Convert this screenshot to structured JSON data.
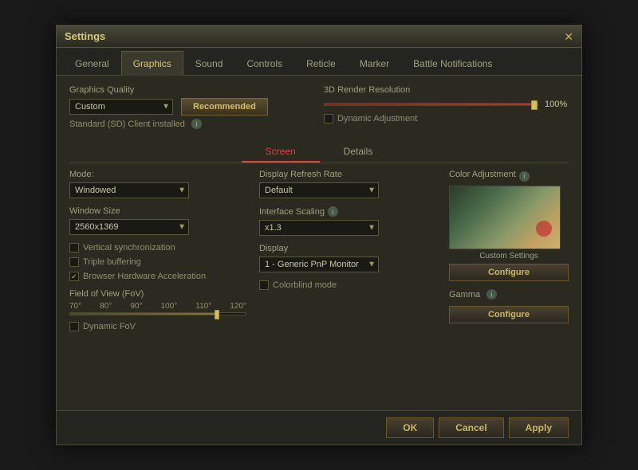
{
  "dialog": {
    "title": "Settings",
    "close_label": "✕"
  },
  "tabs": [
    {
      "id": "general",
      "label": "General",
      "active": false
    },
    {
      "id": "graphics",
      "label": "Graphics",
      "active": true
    },
    {
      "id": "sound",
      "label": "Sound",
      "active": false
    },
    {
      "id": "controls",
      "label": "Controls",
      "active": false
    },
    {
      "id": "reticle",
      "label": "Reticle",
      "active": false
    },
    {
      "id": "marker",
      "label": "Marker",
      "active": false
    },
    {
      "id": "battle_notifications",
      "label": "Battle Notifications",
      "active": false
    }
  ],
  "graphics": {
    "quality_label": "Graphics Quality",
    "quality_value": "Custom",
    "recommended_btn": "Recommended",
    "sd_label": "Standard (SD) Client installed",
    "render_label": "3D Render Resolution",
    "render_pct": "100%",
    "dynamic_adj_label": "Dynamic Adjustment",
    "sub_tabs": [
      {
        "id": "screen",
        "label": "Screen",
        "active": true
      },
      {
        "id": "details",
        "label": "Details",
        "active": false
      }
    ],
    "screen": {
      "mode_label": "Mode:",
      "mode_value": "Windowed",
      "window_size_label": "Window Size",
      "window_size_value": "2560x1369",
      "vertical_sync_label": "Vertical synchronization",
      "triple_buffer_label": "Triple buffering",
      "browser_hw_label": "Browser Hardware Acceleration",
      "browser_hw_checked": true,
      "fov_label": "Field of View (FoV)",
      "fov_markers": [
        "70°",
        "80°",
        "90°",
        "100°",
        "110°",
        "120°"
      ],
      "dynamic_fov_label": "Dynamic FoV",
      "display_refresh_label": "Display Refresh Rate",
      "display_refresh_value": "Default",
      "interface_scaling_label": "Interface Scaling",
      "interface_scaling_value": "x1.3",
      "display_label": "Display",
      "display_value": "1 - Generic PnP Monitor",
      "colorblind_label": "Colorblind mode",
      "color_adj_label": "Color Adjustment",
      "custom_settings_label": "Custom Settings",
      "configure_btn": "Configure",
      "gamma_label": "Gamma",
      "gamma_configure_btn": "Configure"
    }
  },
  "footer": {
    "ok_btn": "OK",
    "cancel_btn": "Cancel",
    "apply_btn": "Apply"
  }
}
